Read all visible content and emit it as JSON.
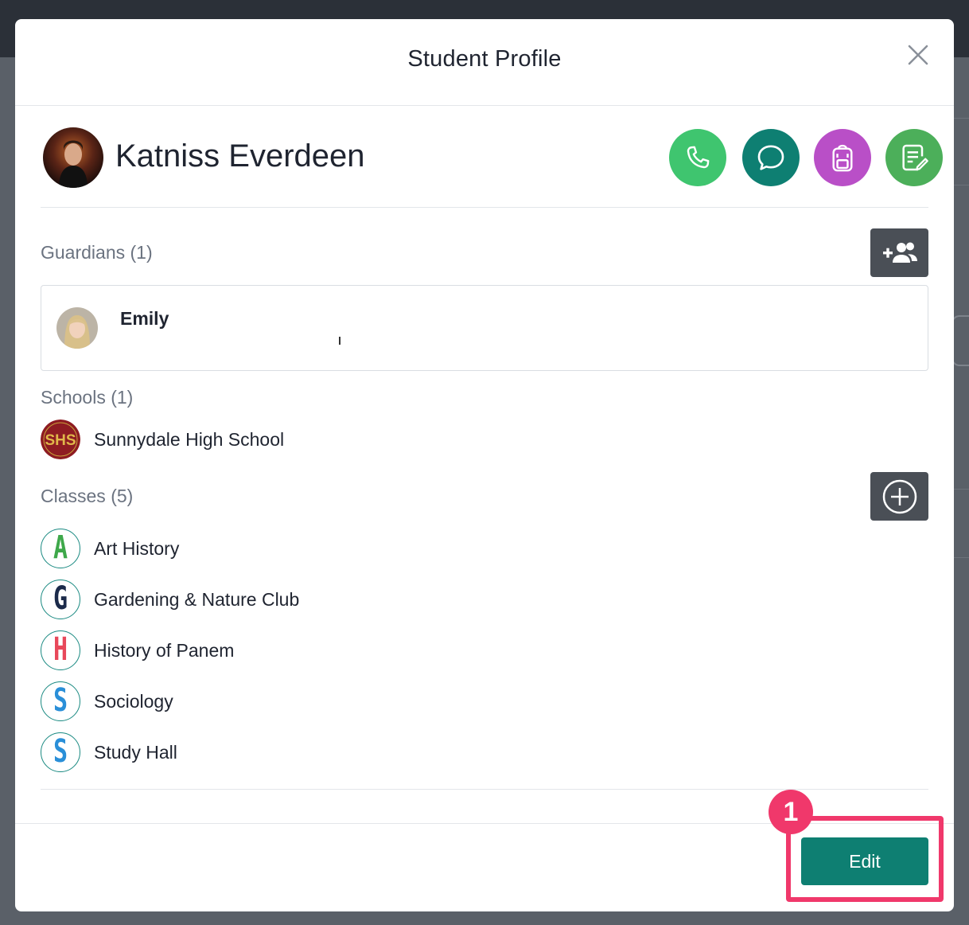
{
  "modal": {
    "title": "Student Profile"
  },
  "student": {
    "name": "Katniss Everdeen"
  },
  "actions": [
    {
      "icon": "phone-icon",
      "color": "#3fc56f"
    },
    {
      "icon": "chat-icon",
      "color": "#0e7f72"
    },
    {
      "icon": "backpack-icon",
      "color": "#b94fc7"
    },
    {
      "icon": "notes-edit-icon",
      "color": "#4caf5a"
    }
  ],
  "guardians": {
    "label": "Guardians (1)",
    "items": [
      {
        "name": "Emily"
      }
    ]
  },
  "schools": {
    "label": "Schools (1)",
    "items": [
      {
        "name": "Sunnydale High School",
        "logo_text": "SHS"
      }
    ]
  },
  "classes": {
    "label": "Classes (5)",
    "items": [
      {
        "name": "Art History",
        "letter": "A",
        "color": "#3ea84a"
      },
      {
        "name": "Gardening & Nature Club",
        "letter": "G",
        "color": "#1b2a4a"
      },
      {
        "name": "History of Panem",
        "letter": "H",
        "color": "#e8485a"
      },
      {
        "name": "Sociology",
        "letter": "S",
        "color": "#2a8fd8"
      },
      {
        "name": "Study Hall",
        "letter": "S",
        "color": "#2a8fd8"
      }
    ]
  },
  "footer": {
    "edit_label": "Edit",
    "step_number": "1"
  },
  "colors": {
    "accent": "#0e7f72",
    "highlight": "#f0386b"
  }
}
